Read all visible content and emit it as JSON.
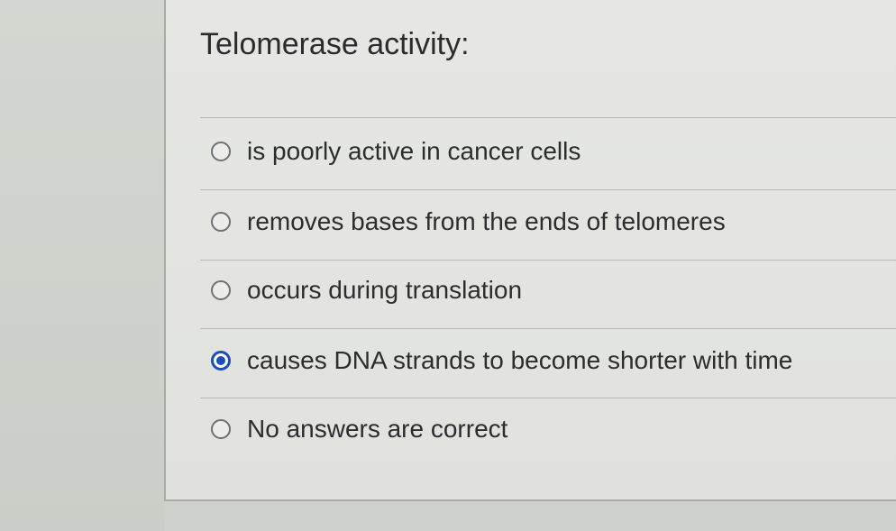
{
  "question": {
    "title": "Telomerase activity:"
  },
  "options": [
    {
      "label": "is poorly active in cancer cells",
      "selected": false
    },
    {
      "label": "removes bases from the ends of telomeres",
      "selected": false
    },
    {
      "label": "occurs during translation",
      "selected": false
    },
    {
      "label": "causes DNA strands to become shorter with time",
      "selected": true
    },
    {
      "label": "No answers are correct",
      "selected": false
    }
  ],
  "colors": {
    "accent": "#1d4fb8",
    "text": "#2c2d2f",
    "card_background": "#e4e5e1"
  },
  "icons": {
    "unselected": "radio-unchecked-icon",
    "selected": "radio-checked-icon"
  }
}
